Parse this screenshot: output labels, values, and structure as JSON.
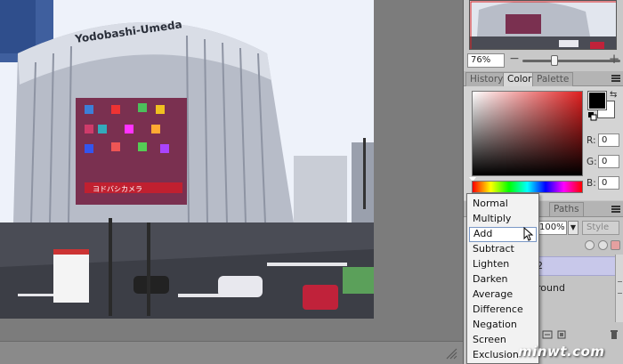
{
  "photo": {
    "building_sign": "Yodobashi-Umeda",
    "store_sign": "ヨドバシカメラ"
  },
  "navigator": {
    "zoom_value": "76%",
    "zoom_level": 0.76
  },
  "color_panel": {
    "tabs": [
      {
        "label": "History",
        "active": false
      },
      {
        "label": "Color",
        "active": true
      },
      {
        "label": "Palette",
        "active": false
      }
    ],
    "foreground": "#000000",
    "background": "#ffffff",
    "r_label": "R:",
    "g_label": "G:",
    "b_label": "B:",
    "r_value": "0",
    "g_value": "0",
    "b_value": "0"
  },
  "layers_panel": {
    "tabs": [
      {
        "label": "Paths",
        "active": false
      }
    ],
    "opacity_value": "100%",
    "style_label": "Style",
    "layer_selected_text": "2",
    "layer_background_text": "round"
  },
  "blend_menu": {
    "items": [
      {
        "label": "Normal"
      },
      {
        "label": "Multiply"
      },
      {
        "label": "Add",
        "hover": true
      },
      {
        "label": "Subtract"
      },
      {
        "label": "Lighten"
      },
      {
        "label": "Darken"
      },
      {
        "label": "Average"
      },
      {
        "label": "Difference"
      },
      {
        "label": "Negation"
      },
      {
        "label": "Screen"
      },
      {
        "label": "Exclusion"
      }
    ]
  },
  "watermark": "minwt.com",
  "colors": {
    "workspace": "#7c7c7c",
    "panel": "#c8c8c8",
    "menu_hover_border": "#7a98c6",
    "layer_selected": "#c8c8ea"
  }
}
